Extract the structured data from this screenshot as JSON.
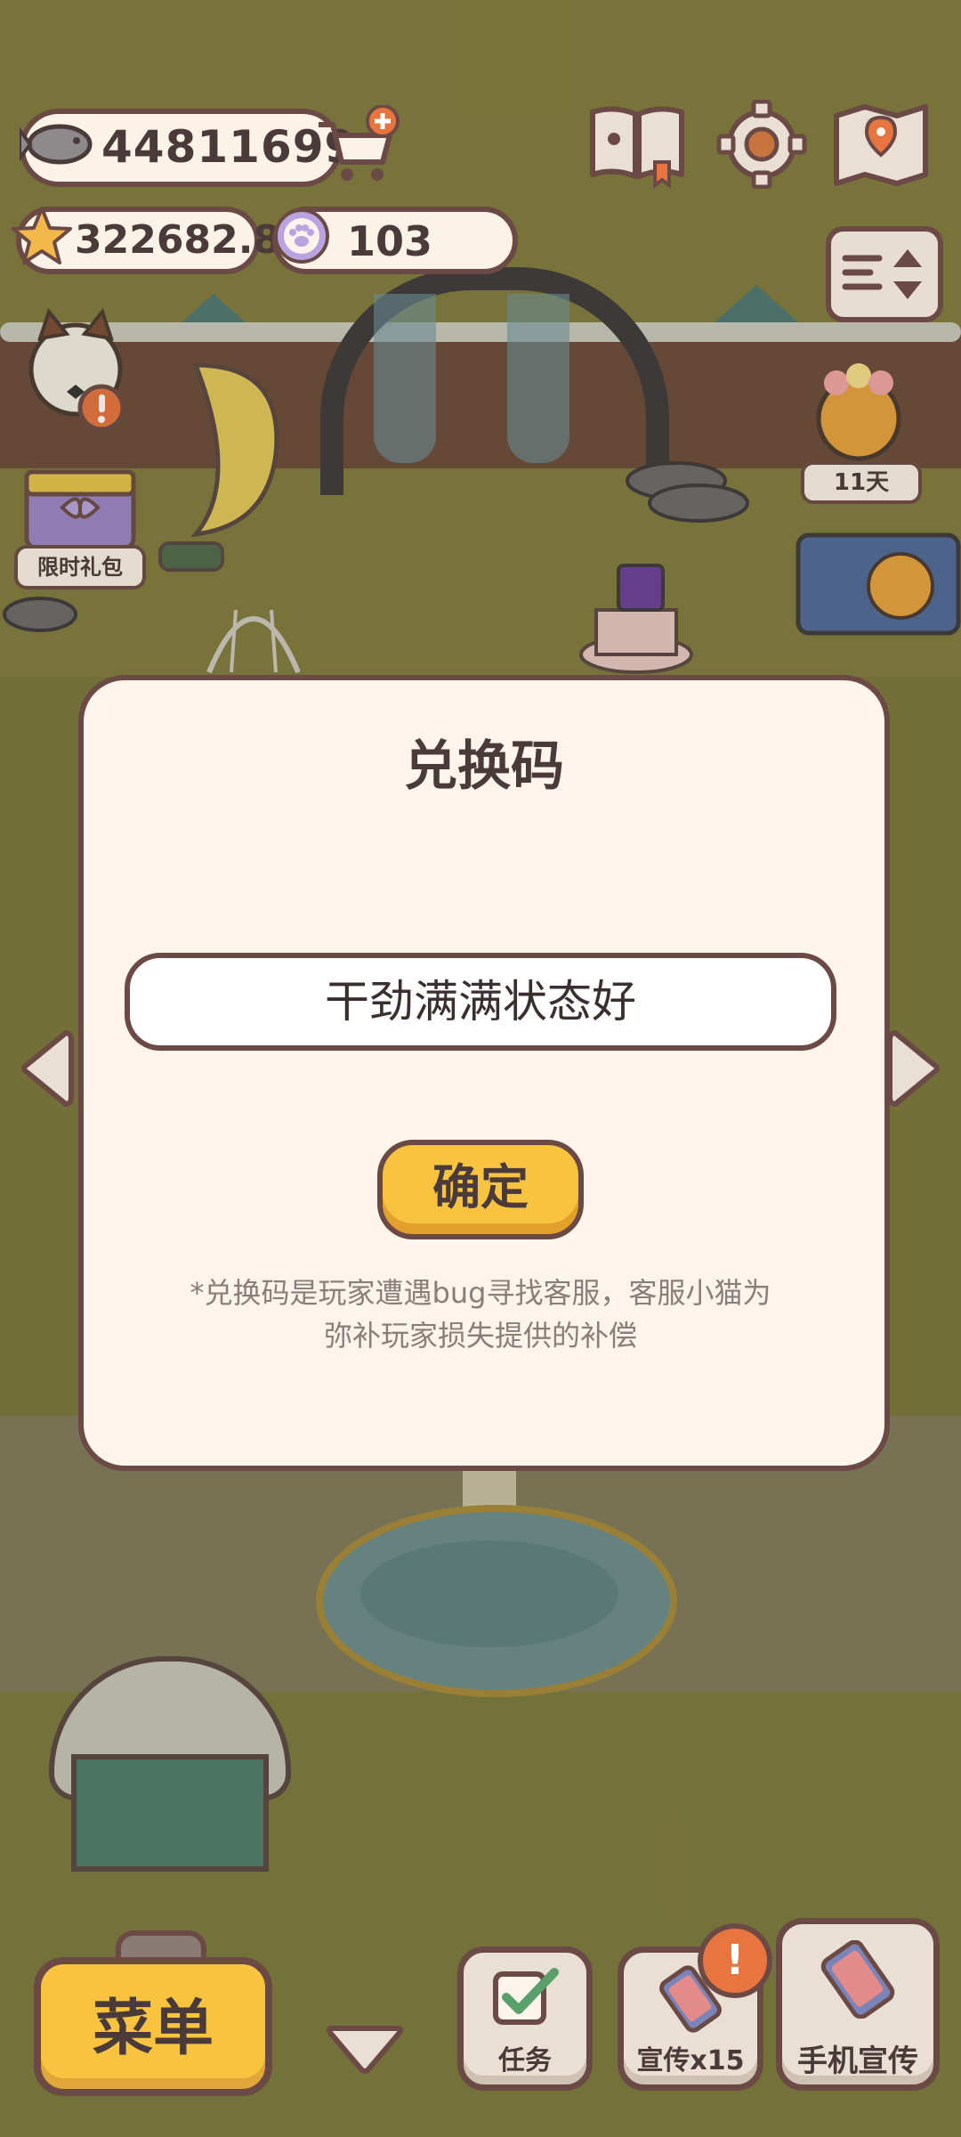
{
  "hud": {
    "fish_coins": "44811699",
    "stars": "322682.8",
    "paws": "103"
  },
  "scene": {
    "gift_label": "限时礼包",
    "days_label": "11天"
  },
  "dialog": {
    "title": "兑换码",
    "code_value": "干劲满满状态好",
    "confirm_label": "确定",
    "note_line1": "*兑换码是玩家遭遇bug寻找客服，客服小猫为",
    "note_line2": "弥补玩家损失提供的补偿"
  },
  "bottom_bar": {
    "menu_label": "菜单",
    "task_label": "任务",
    "promo_label": "宣传x15",
    "phone_promo_label": "手机宣传",
    "badge_symbol": "!"
  },
  "colors": {
    "outline": "#6b4a45",
    "panel": "#fdf5ec",
    "button_yellow": "#f8c440",
    "badge_orange": "#e8743f",
    "text": "#4a3b3a"
  },
  "icons": [
    "fish-icon",
    "shop-cart-icon",
    "star-icon",
    "paw-icon",
    "book-icon",
    "gear-icon",
    "map-icon",
    "toggle-icon",
    "left-arrow-icon",
    "right-arrow-icon",
    "down-arrow-icon",
    "checkbox-icon",
    "phone-icon",
    "alert-icon"
  ]
}
